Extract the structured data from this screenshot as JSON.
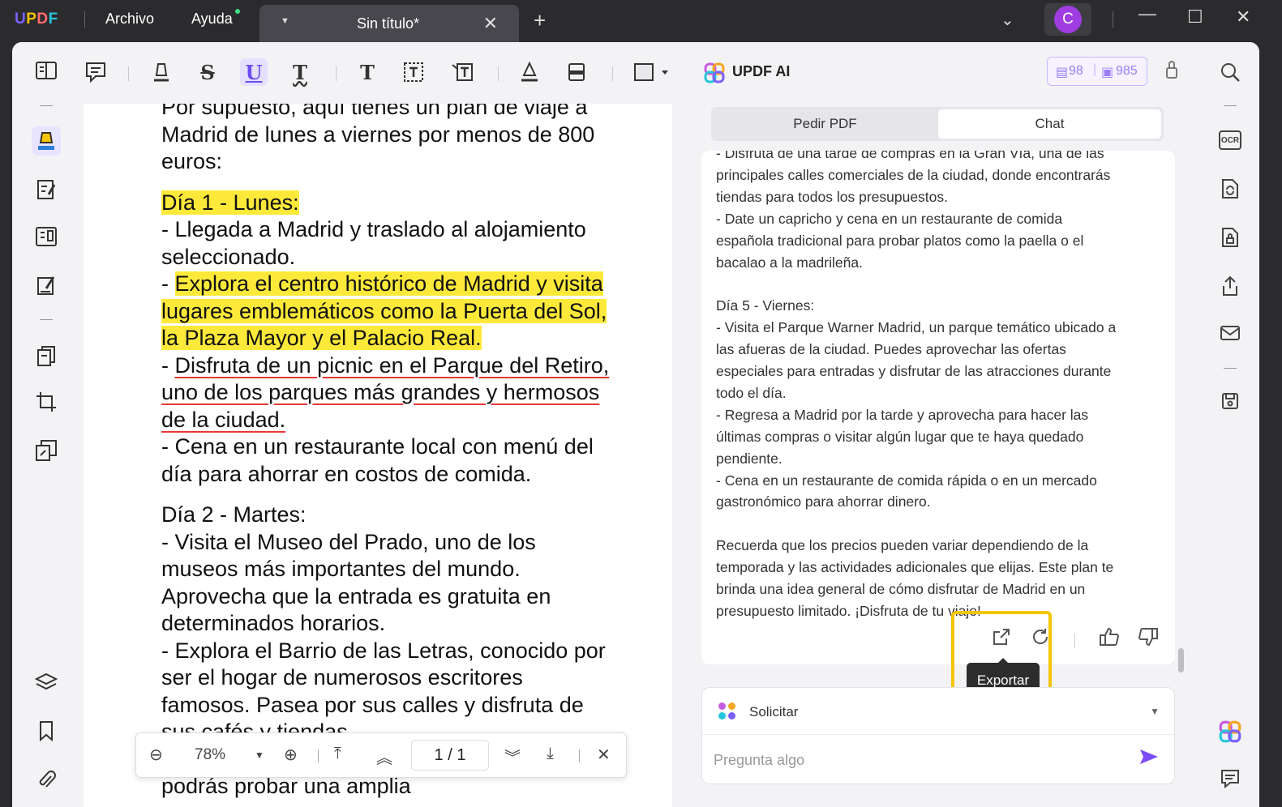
{
  "app": {
    "logo": "UPDF",
    "menu": [
      "Archivo",
      "Ayuda"
    ],
    "tab_title": "Sin título*",
    "avatar_letter": "C"
  },
  "document": {
    "paragraphs": [
      {
        "text": "Por supuesto, aquí tienes un plan de viaje a Madrid de lunes a viernes por menos de 800 euros:",
        "style": "normal"
      },
      {
        "gap": true
      },
      {
        "text": "Día 1 - Lunes:",
        "style": "highlight"
      },
      {
        "text": "- Llegada a Madrid y traslado al alojamiento seleccionado.",
        "style": "normal"
      },
      {
        "prefix": "- ",
        "text": "Explora el centro histórico de Madrid y visita lugares emblemáticos como la Puerta del Sol, la Plaza Mayor y el Palacio Real.",
        "style": "highlight"
      },
      {
        "prefix": "- ",
        "text": "Disfruta de un picnic en el Parque del Retiro, uno de los parques más grandes y hermosos de la ciudad.",
        "style": "underline"
      },
      {
        "text": "- Cena en un restaurante local con menú del día para ahorrar en costos de comida.",
        "style": "normal"
      },
      {
        "gap": true
      },
      {
        "text": "Día 2 - Martes:",
        "style": "normal"
      },
      {
        "text": "- Visita el Museo del Prado, uno de los museos más importantes del mundo. Aprovecha que la entrada es gratuita en determinados horarios.",
        "style": "normal"
      },
      {
        "text": "- Explora el Barrio de las Letras, conocido por ser el hogar de numerosos escritores famosos. Pasea por sus calles y disfruta de sus cafés y tiendas.",
        "style": "normal"
      },
      {
        "text": "- Cena en el Mercado de San Miguel, donde podrás probar una amplia",
        "style": "normal"
      }
    ]
  },
  "zoombar": {
    "zoom": "78%",
    "page_indicator": "1 / 1"
  },
  "ai": {
    "title": "UPDF AI",
    "credits_docs": "98",
    "credits_chat": "985",
    "tabs": [
      "Pedir PDF",
      "Chat"
    ],
    "selected_tab": "Chat",
    "chat_lines": [
      "- Disfruta de una tarde de compras en la Gran Vía, una de las",
      "principales calles comerciales de la ciudad, donde encontrarás",
      "tiendas para todos los presupuestos.",
      "- Date un capricho y cena en un restaurante de comida",
      "española tradicional para probar platos como la paella o el",
      "bacalao a la madrileña.",
      "",
      "Día 5 - Viernes:",
      "- Visita el Parque Warner Madrid, un parque temático ubicado a",
      "las afueras de la ciudad. Puedes aprovechar las ofertas",
      "especiales para entradas y disfrutar de las atracciones durante",
      "todo el día.",
      "- Regresa a Madrid por la tarde y aprovecha para hacer las",
      "últimas compras o visitar algún lugar que te haya quedado",
      "pendiente.",
      "- Cena en un restaurante de comida rápida o en un mercado",
      "gastronómico para ahorrar dinero.",
      "",
      "Recuerda que los precios pueden variar dependiendo de la",
      "temporada y las actividades adicionales que elijas. Este plan te",
      "brinda una idea general de cómo disfrutar de Madrid en un",
      "presupuesto limitado. ¡Disfruta de tu viaje!"
    ],
    "tooltip": "Exportar",
    "prompt_label": "Solicitar",
    "input_placeholder": "Pregunta algo"
  },
  "colors": {
    "accent": "#7a4df5",
    "highlight": "#fde93a",
    "export_frame": "#f5c400"
  }
}
